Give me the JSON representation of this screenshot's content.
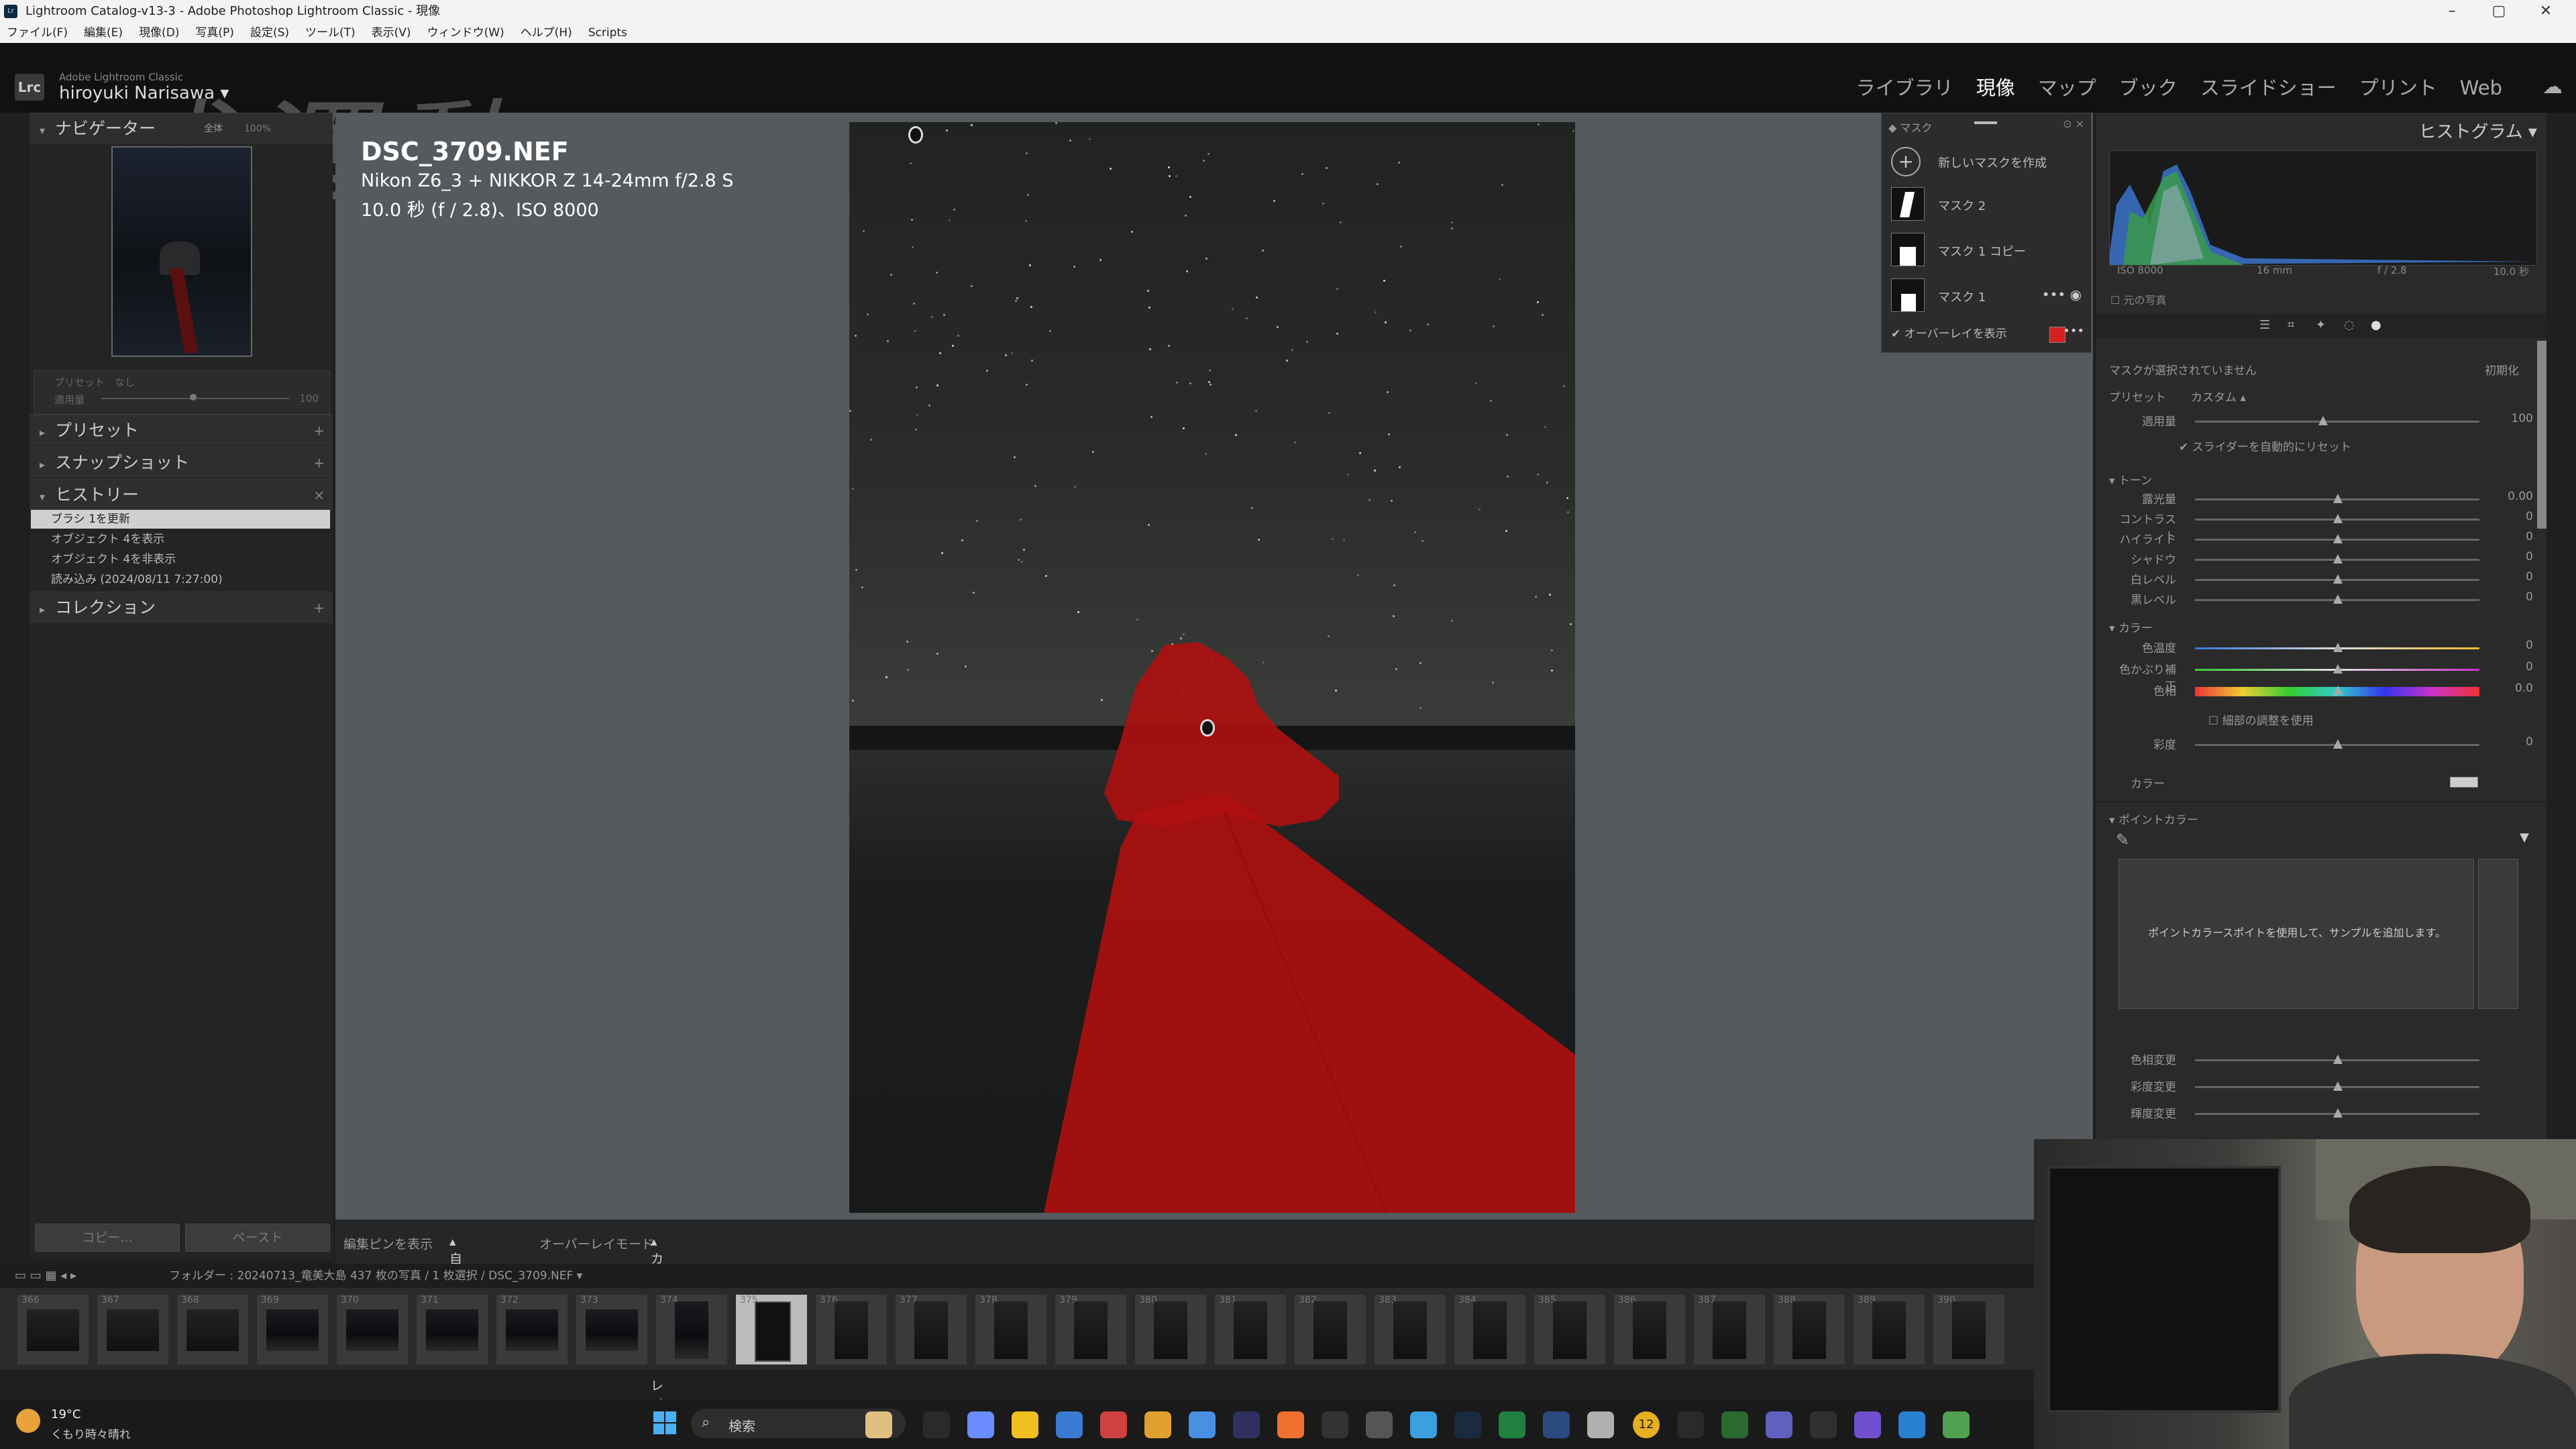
{
  "window": {
    "title": "Lightroom Catalog-v13-3 - Adobe Photoshop Lightroom Classic - 現像"
  },
  "menu": [
    "ファイル(F)",
    "編集(E)",
    "現像(D)",
    "写真(P)",
    "設定(S)",
    "ツール(T)",
    "表示(V)",
    "ウィンドウ(W)",
    "ヘルプ(H)",
    "Scripts"
  ],
  "identity": {
    "product": "Adobe Lightroom Classic",
    "user": "hiroyuki Narisawa",
    "logo_text": "成澤勲"
  },
  "modules": [
    "ライブラリ",
    "現像",
    "マップ",
    "ブック",
    "スライドショー",
    "プリント",
    "Web"
  ],
  "left_panel": {
    "navigator_title": "ナビゲーター",
    "navigator_zoom": [
      "全体",
      "100%"
    ],
    "preset_label": "プリセット",
    "preset_value": "なし",
    "amount_label": "適用量",
    "amount_value": "100",
    "sections": {
      "presets": "プリセット",
      "snapshots": "スナップショット",
      "history": "ヒストリー",
      "collections": "コレクション"
    },
    "history_items": [
      "ブラシ 1を更新",
      "オブジェクト 4を表示",
      "オブジェクト 4を非表示",
      "読み込み (2024/08/11 7:27:00)"
    ],
    "copy_button": "コピー...",
    "paste_button": "ペースト"
  },
  "photo_info": {
    "filename": "DSC_3709.NEF",
    "camera": "Nikon Z6_3 + NIKKOR Z 14-24mm f/2.8 S",
    "exposure": "10.0 秒 (f / 2.8)、ISO 8000"
  },
  "mask_panel": {
    "title": "マスク",
    "create_new": "新しいマスクを作成",
    "masks": [
      "マスク 2",
      "マスク 1 コピー",
      "マスク 1"
    ],
    "overlay_label": "オーバーレイを表示",
    "overlay_color": "#d42020"
  },
  "right_panel": {
    "histogram_title": "ヒストグラム",
    "histogram_info": [
      "ISO 8000",
      "16 mm",
      "f / 2.8",
      "10.0 秒"
    ],
    "original_photo": "元の写真",
    "no_mask": "マスクが選択されていません",
    "initialize": "初期化",
    "preset_label": "プリセット",
    "preset_value": "カスタム",
    "amount_label": "適用量",
    "amount_value": "100",
    "auto_reset": "スライダーを自動的にリセット",
    "tone_section": "トーン",
    "tone_sliders": [
      {
        "label": "露光量",
        "value": "0.00"
      },
      {
        "label": "コントラスト",
        "value": "0"
      },
      {
        "label": "ハイライト",
        "value": "0"
      },
      {
        "label": "シャドウ",
        "value": "0"
      },
      {
        "label": "白レベル",
        "value": "0"
      },
      {
        "label": "黒レベル",
        "value": "0"
      }
    ],
    "color_section": "カラー",
    "color_sliders": [
      {
        "label": "色温度",
        "value": "0"
      },
      {
        "label": "色かぶり補正",
        "value": "0"
      },
      {
        "label": "色相",
        "value": "0.0"
      }
    ],
    "fine_adjust": "細部の調整を使用",
    "saturation_label": "彩度",
    "saturation_value": "0",
    "color_label": "カラー",
    "point_color_section": "ポイントカラー",
    "point_color_hint": "ポイントカラースポイトを使用して、サンプルを追加します。",
    "point_sliders": [
      "色相変更",
      "彩度変更",
      "輝度変更"
    ]
  },
  "bottom_toolbar": {
    "show_pins": "編集ピンを表示",
    "auto": "自動",
    "overlay_mode": "オーバーレイモード",
    "color_overlay": "カラーオーバーレイ"
  },
  "filmstrip": {
    "path": "フォルダー : 20240713_竜美大島 437 枚の写真 / 1 枚選択 / DSC_3709.NEF",
    "numbers": [
      "366",
      "367",
      "368",
      "369",
      "370",
      "371",
      "372",
      "373",
      "374",
      "375",
      "376",
      "377",
      "378",
      "379",
      "380",
      "381",
      "382",
      "383",
      "384",
      "385",
      "386",
      "387",
      "388",
      "389",
      "390"
    ],
    "selected_index": 9
  },
  "taskbar": {
    "temperature": "19°C",
    "weather": "くもり時々晴れ",
    "search": "検索",
    "badge_count": "12"
  }
}
